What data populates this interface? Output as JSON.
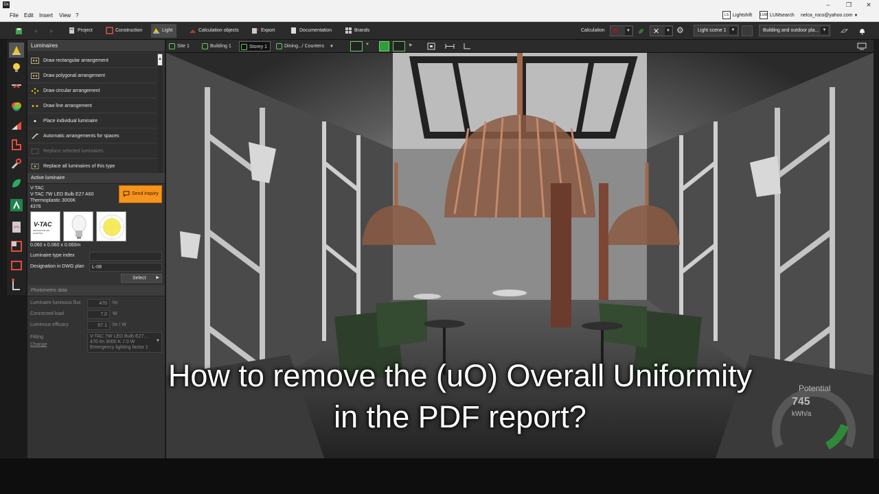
{
  "window": {
    "app_icon": "Dx",
    "buttons": [
      "–",
      "❐",
      "✕"
    ]
  },
  "menubar": {
    "items": [
      "File",
      "Edit",
      "Insert",
      "View",
      "?"
    ],
    "lightshift": {
      "badge": "LS",
      "label": "Lightshift"
    },
    "lumsearch": {
      "badge": "LUM",
      "label": "LUMsearch"
    },
    "user": "nelca_roco@yahoo.com"
  },
  "toolbar": {
    "tabs": [
      {
        "label": "Project",
        "icon": "project-icon"
      },
      {
        "label": "Construction",
        "icon": "construction-icon"
      },
      {
        "label": "Light",
        "icon": "light-icon",
        "active": true
      },
      {
        "label": "Calculation objects",
        "icon": "calculation-objects-icon"
      },
      {
        "label": "Export",
        "icon": "export-icon"
      },
      {
        "label": "Documentation",
        "icon": "documentation-icon"
      },
      {
        "label": "Brands",
        "icon": "brands-icon"
      }
    ],
    "calculation_label": "Calculation",
    "light_scene": "Light scene 1",
    "building_scope": "Building and outdoor pla..."
  },
  "panel": {
    "luminaires_header": "Luminaires",
    "actions": [
      {
        "label": "Draw rectangular arrangement",
        "enabled": true
      },
      {
        "label": "Draw polygonal arrangement",
        "enabled": true
      },
      {
        "label": "Draw circular arrangement",
        "enabled": true
      },
      {
        "label": "Draw line arrangement",
        "enabled": true
      },
      {
        "label": "Place individual luminaire",
        "enabled": true
      },
      {
        "label": "Automatic arrangements for spaces",
        "enabled": true
      },
      {
        "label": "Replace selected luminaires",
        "enabled": false
      },
      {
        "label": "Replace all luminaires of this type",
        "enabled": true
      }
    ],
    "active_luminaire": {
      "header": "Active luminaire",
      "manufacturer": "V-TAC",
      "name": "V-TAC 7W LED Bulb E27 A60",
      "material": "Thermoplastic 3000K",
      "article": "4376",
      "send_inquiry": "Send inquiry",
      "logo_text": "V-TAC",
      "logo_sub": "INNOVATIVE LED LIGHTING",
      "dimensions": "0.060 x 0.060 x 0.060m",
      "type_index_label": "Luminaire type index",
      "type_index_value": "",
      "designation_label": "Designation in DWG plan",
      "designation_value": "L-08",
      "select_label": "Select"
    },
    "photometric": {
      "header": "Photometric data",
      "flux_label": "Luminaire luminous flux",
      "flux_value": "470",
      "flux_unit": "lm",
      "load_label": "Connected load",
      "load_value": "7.0",
      "load_unit": "W",
      "efficacy_label": "Luminous efficacy",
      "efficacy_value": "67.1",
      "efficacy_unit": "lm / W",
      "fitting_label": "Fitting",
      "change_label": "Change",
      "fitting_line1": "V-TAC 7W LED Bulb E27...",
      "fitting_line2": "470 lm    3000 K    7.0 W",
      "fitting_line3": "Emergency lighting factor  1"
    }
  },
  "viewtabs": {
    "site": "Site 1",
    "building": "Building 1",
    "storey": "Storey 1",
    "room": "Dining.../ Counters"
  },
  "energy": {
    "label": "Potential",
    "value": "745",
    "unit": "kWh/a"
  },
  "caption": {
    "line1": "How to remove the (uO) Overall Uniformity",
    "line2": "in the PDF report?"
  },
  "colors": {
    "accent_orange": "#f7941d",
    "active_green": "#2e9e3a",
    "panel_bg": "#333333"
  }
}
